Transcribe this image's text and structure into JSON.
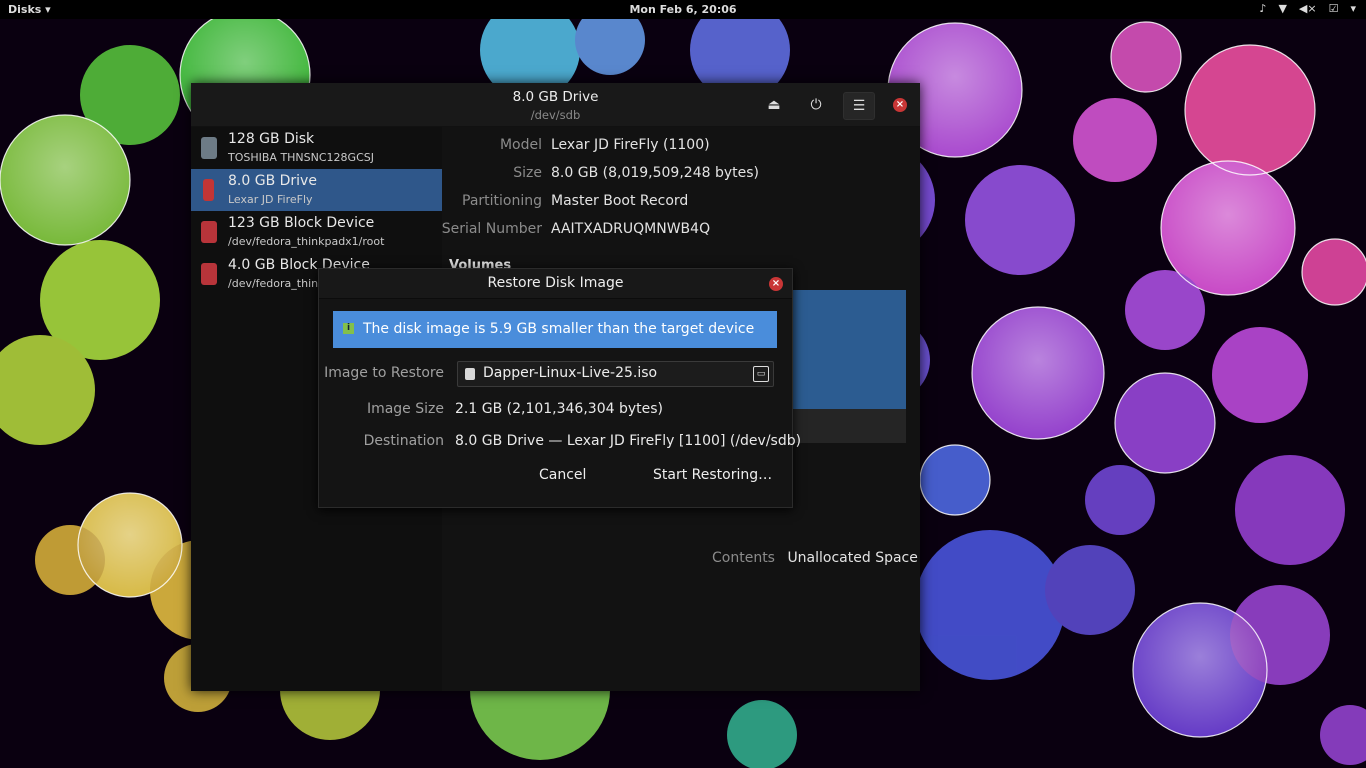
{
  "topbar": {
    "app_menu": "Disks ▾",
    "clock": "Mon Feb  6, 20:06",
    "tray_icons": [
      "music-icon",
      "wifi-icon",
      "volume-icon",
      "checkbox-icon",
      "chevron-down-icon"
    ]
  },
  "window": {
    "title": "8.0 GB Drive",
    "subtitle": "/dev/sdb"
  },
  "sidebar": {
    "items": [
      {
        "label": "128 GB Disk",
        "sub": "TOSHIBA THNSNC128GCSJ",
        "icon": "hard-disk-icon",
        "selected": false
      },
      {
        "label": "8.0 GB Drive",
        "sub": "Lexar JD FireFly",
        "icon": "usb-drive-icon",
        "selected": true
      },
      {
        "label": "123 GB Block Device",
        "sub": "/dev/fedora_thinkpadx1/root",
        "icon": "block-device-icon",
        "selected": false
      },
      {
        "label": "4.0 GB Block Device",
        "sub": "/dev/fedora_thin",
        "icon": "block-device-icon",
        "selected": false
      }
    ]
  },
  "details": {
    "model_label": "Model",
    "model_value": "Lexar JD FireFly (1100)",
    "size_label": "Size",
    "size_value": "8.0 GB (8,019,509,248 bytes)",
    "partitioning_label": "Partitioning",
    "partitioning_value": "Master Boot Record",
    "serial_label": "Serial Number",
    "serial_value": "AAITXADRUQMNWB4Q",
    "volumes_heading": "Volumes",
    "contents_label": "Contents",
    "contents_value": "Unallocated Space"
  },
  "dialog": {
    "title": "Restore Disk Image",
    "info_message": "The disk image is 5.9 GB smaller than the target device",
    "image_label": "Image to Restore",
    "image_file": "Dapper-Linux-Live-25.iso",
    "image_size_label": "Image Size",
    "image_size_value": "2.1 GB (2,101,346,304 bytes)",
    "destination_label": "Destination",
    "destination_value": "8.0 GB Drive — Lexar JD FireFly [1100] (/dev/sdb)",
    "cancel_label": "Cancel",
    "start_label": "Start Restoring…"
  },
  "colors": {
    "selection": "#2f578a",
    "info_bar": "#4a8ddb",
    "close_red": "#c93636"
  }
}
